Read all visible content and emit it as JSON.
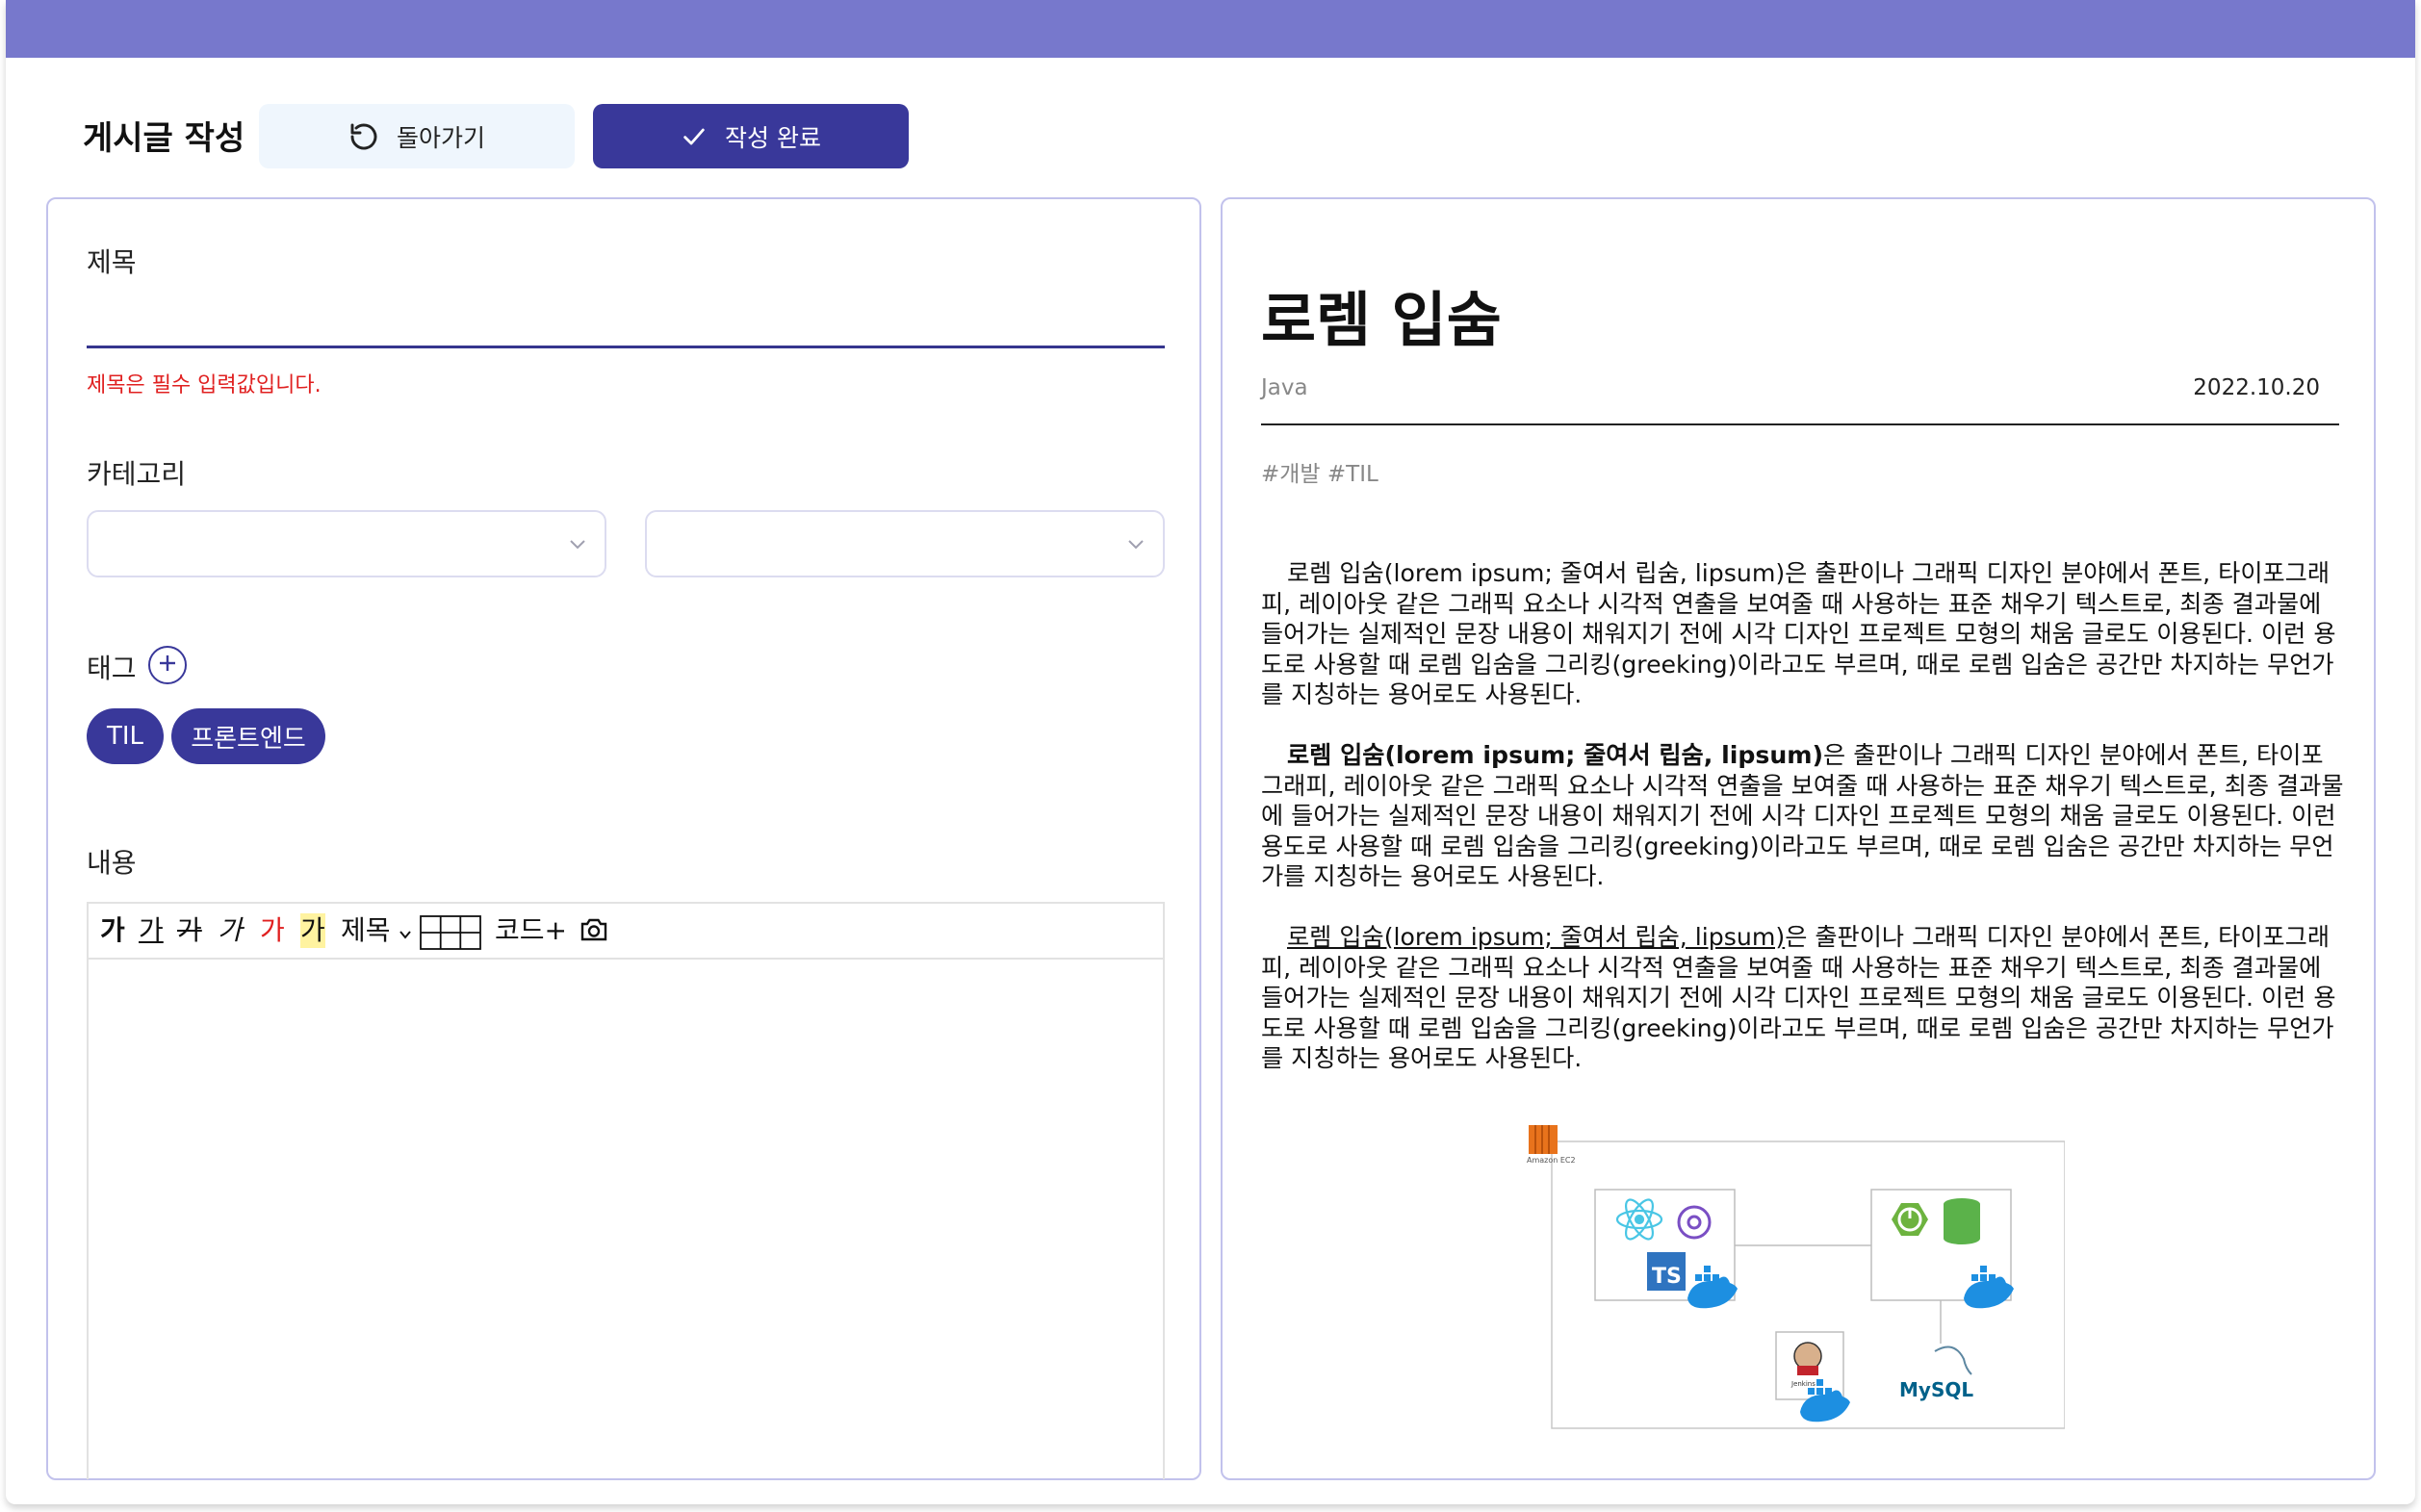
{
  "header": {
    "title": "게시글 작성",
    "back_label": "돌아가기",
    "done_label": "작성 완료"
  },
  "form": {
    "title_label": "제목",
    "title_value": "",
    "title_error": "제목은 필수 입력값입니다.",
    "category_label": "카테고리",
    "category_primary": "",
    "category_secondary": "",
    "tag_label": "태그",
    "tags": [
      "TIL",
      "프론트엔드"
    ],
    "content_label": "내용",
    "toolbar": {
      "bold": "가",
      "underline": "가",
      "strike": "가",
      "italic": "가",
      "color": "가",
      "highlight": "가",
      "heading": "제목",
      "code": "코드+"
    }
  },
  "colors": {
    "topbar": "#7778cc",
    "primary": "#39389a",
    "panel_border": "#c2c2ec",
    "error": "#e02020",
    "back_bg": "#eff6fd",
    "highlight": "#fff3a0"
  },
  "preview": {
    "title": "로렘 입숨",
    "category": "Java",
    "date": "2022.10.20",
    "tags": "#개발 #TIL",
    "paragraph1": "로렘 입숨(lorem ipsum; 줄여서 립숨, lipsum)은 출판이나 그래픽 디자인 분야에서 폰트, 타이포그래피, 레이아웃 같은 그래픽 요소나 시각적 연출을 보여줄 때 사용하는 표준 채우기 텍스트로, 최종 결과물에 들어가는 실제적인 문장 내용이 채워지기 전에 시각 디자인 프로젝트 모형의 채움 글로도 이용된다. 이런 용도로 사용할 때 로렘 입숨을 그리킹(greeking)이라고도 부르며, 때로 로렘 입숨은 공간만 차지하는 무언가를 지칭하는 용어로도 사용된다.",
    "paragraph2_bold": "로렘 입숨(lorem ipsum; 줄여서 립숨, lipsum)",
    "paragraph2_rest": "은 출판이나 그래픽 디자인 분야에서 폰트, 타이포그래피, 레이아웃 같은 그래픽 요소나 시각적 연출을 보여줄 때 사용하는 표준 채우기 텍스트로, 최종 결과물에 들어가는 실제적인 문장 내용이 채워지기 전에 시각 디자인 프로젝트 모형의 채움 글로도 이용된다. 이런 용도로 사용할 때 로렘 입숨을 그리킹(greeking)이라고도 부르며, 때로 로렘 입숨은 공간만 차지하는 무언가를 지칭하는 용어로도 사용된다.",
    "paragraph3_underlined": "로렘 입숨(lorem ipsum; 줄여서 립숨, lipsum)",
    "paragraph3_rest": "은 출판이나 그래픽 디자인 분야에서 폰트, 타이포그래피, 레이아웃 같은 그래픽 요소나 시각적 연출을 보여줄 때 사용하는 표준 채우기 텍스트로, 최종 결과물에 들어가는 실제적인 문장 내용이 채워지기 전에 시각 디자인 프로젝트 모형의 채움 글로도 이용된다. 이런 용도로 사용할 때 로렘 입숨을 그리킹(greeking)이라고도 부르며, 때로 로렘 입숨은 공간만 차지하는 무언가를 지칭하는 용어로도 사용된다.",
    "diagram": {
      "ec2_label": "Amazon EC2",
      "ts_label": "TS",
      "jenkins_label": "Jenkins",
      "mysql_label": "MySQL"
    }
  }
}
